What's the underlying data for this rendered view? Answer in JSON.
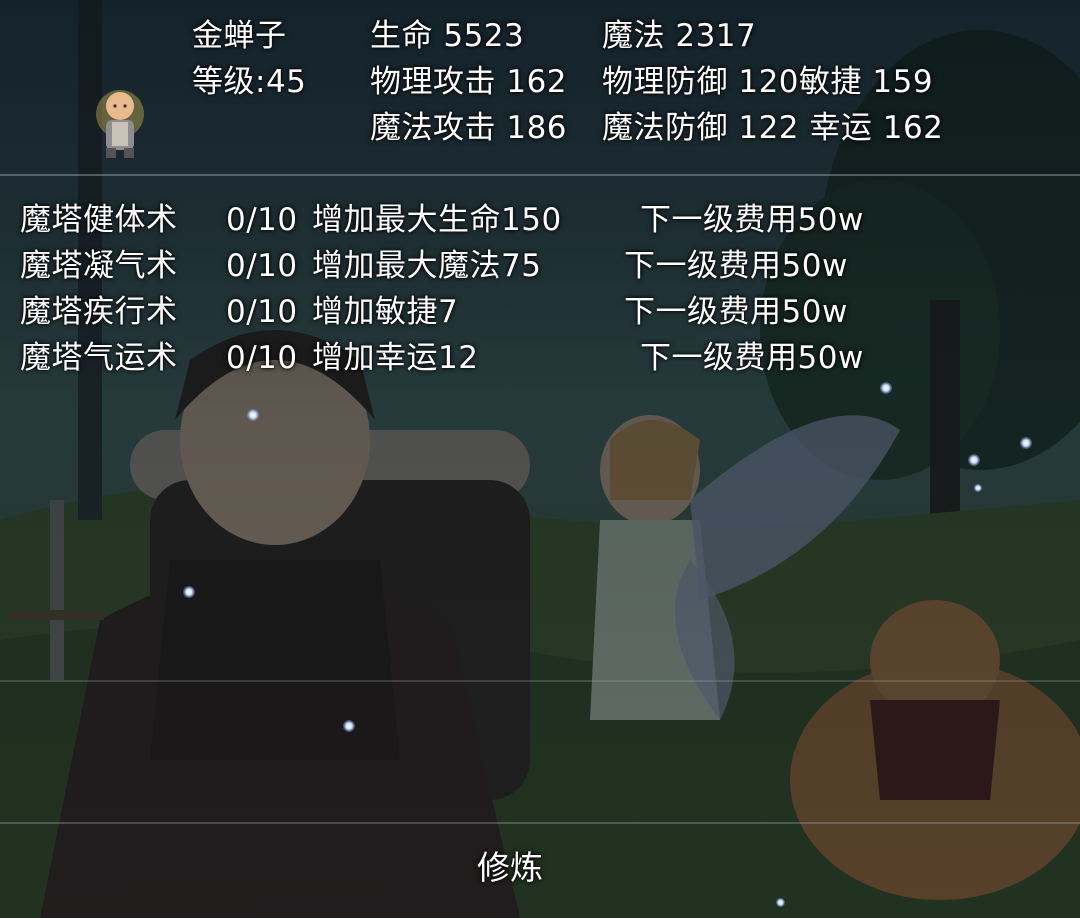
{
  "character": {
    "name": "金蝉子",
    "level_label": "等级:45",
    "avatar_icon": "monk-portrait-icon"
  },
  "stats": {
    "hp": "生命 5523",
    "mp": "魔法 2317",
    "phys_atk": "物理攻击 162",
    "phys_def_agility": "物理防御 120敏捷 159",
    "mag_atk": "魔法攻击 186",
    "mag_def_luck": "魔法防御 122 幸运 162"
  },
  "skills": [
    {
      "name": "魔塔健体术",
      "progress": "0/10",
      "effect": "增加最大生命150",
      "cost": "下一级费用50w"
    },
    {
      "name": "魔塔凝气术",
      "progress": "0/10",
      "effect": "增加最大魔法75",
      "cost": "下一级费用50w"
    },
    {
      "name": "魔塔疾行术",
      "progress": "0/10",
      "effect": "增加敏捷7",
      "cost": "下一级费用50w"
    },
    {
      "name": "魔塔气运术",
      "progress": "0/10",
      "effect": "增加幸运12",
      "cost": "下一级费用50w"
    }
  ],
  "actions": {
    "train_label": "修炼"
  },
  "colors": {
    "text": "#ffffff",
    "divider": "#a0aab4",
    "sparkle": "#cfe0ff"
  }
}
